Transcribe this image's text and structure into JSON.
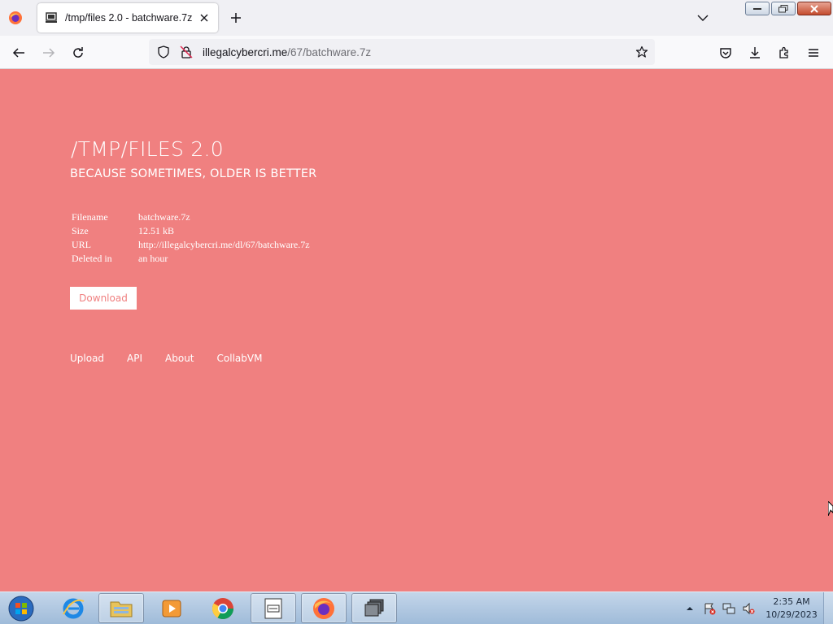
{
  "browser": {
    "tab": {
      "title": "/tmp/files 2.0 - batchware.7z"
    },
    "url": {
      "host": "illegalcybercri.me",
      "path": "/67/batchware.7z"
    }
  },
  "page": {
    "title": "/TMP/FILES 2.0",
    "subtitle": "BECAUSE SOMETIMES, OLDER IS BETTER",
    "file_info": [
      {
        "label": "Filename",
        "value": "batchware.7z"
      },
      {
        "label": "Size",
        "value": "12.51 kB"
      },
      {
        "label": "URL",
        "value": "http://illegalcybercri.me/dl/67/batchware.7z"
      },
      {
        "label": "Deleted in",
        "value": "an hour"
      }
    ],
    "download_label": "Download",
    "nav": [
      {
        "label": "Upload"
      },
      {
        "label": "API"
      },
      {
        "label": "About"
      },
      {
        "label": "CollabVM"
      }
    ],
    "bg_color": "#f08080"
  },
  "taskbar": {
    "apps": [
      {
        "icon": "internet-explorer-icon"
      },
      {
        "icon": "file-explorer-icon"
      },
      {
        "icon": "media-player-icon"
      },
      {
        "icon": "chrome-icon"
      },
      {
        "icon": "document-icon"
      },
      {
        "icon": "firefox-icon"
      },
      {
        "icon": "window-switcher-icon"
      }
    ],
    "clock": {
      "time": "2:35 AM",
      "date": "10/29/2023"
    }
  }
}
